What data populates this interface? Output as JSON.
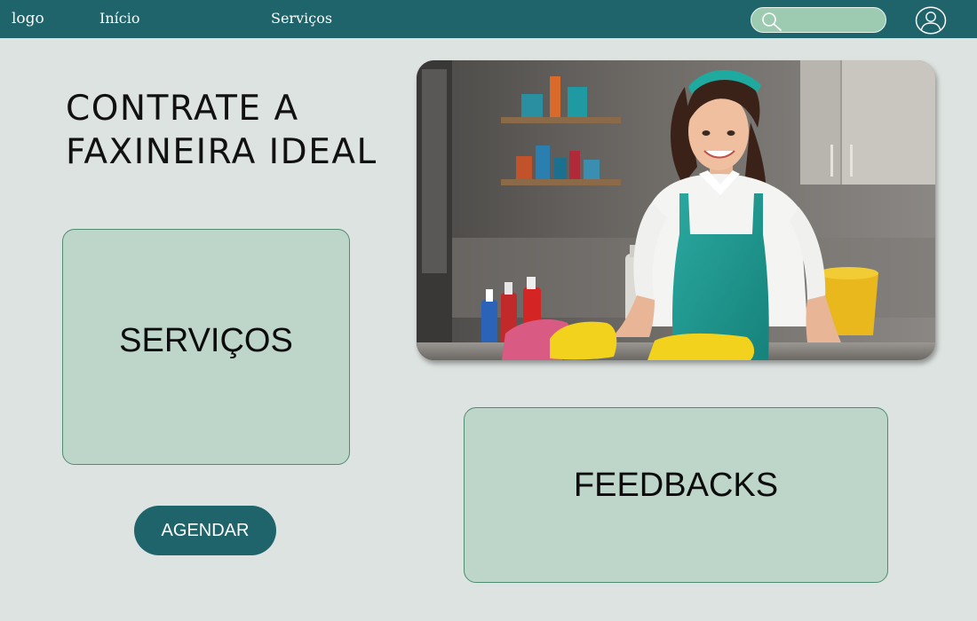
{
  "header": {
    "logo": "logo",
    "nav": [
      "Início",
      "Serviços"
    ],
    "search_placeholder": "",
    "icons": [
      "search-icon",
      "user-profile-icon"
    ]
  },
  "hero": {
    "title_line1": "CONTRATE A",
    "title_line2": "FAXINEIRA IDEAL"
  },
  "cards": {
    "services": "SERVIÇOS",
    "feedbacks": "FEEDBACKS"
  },
  "actions": {
    "schedule": "AGENDAR"
  },
  "colors": {
    "header_bg": "#1f646a",
    "page_bg": "#dde3e0",
    "card_bg": "#bed6c9",
    "card_border": "#4f8c70",
    "search_bg": "#9ccbb2",
    "button_bg": "#1f646a"
  }
}
